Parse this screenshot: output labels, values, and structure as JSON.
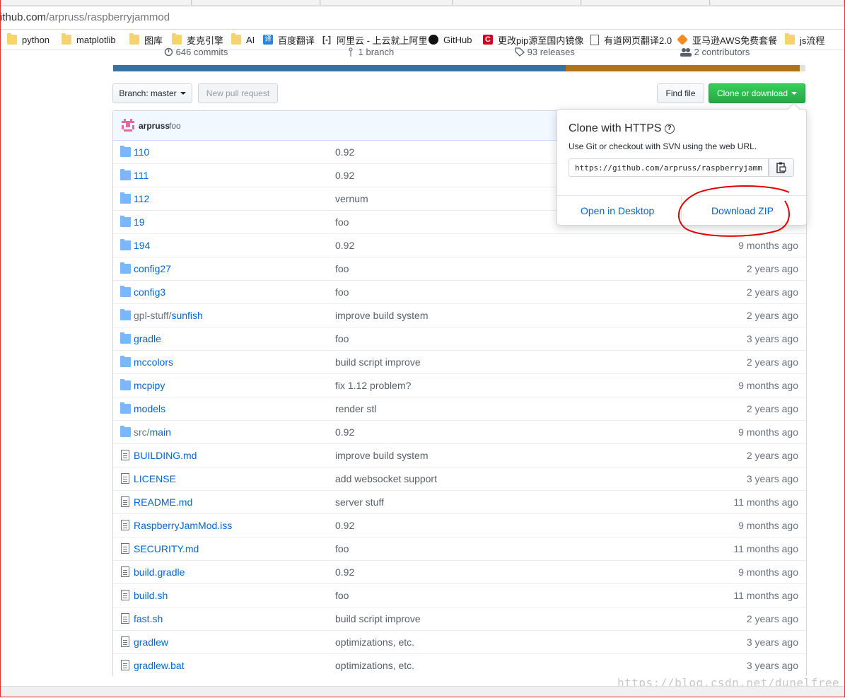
{
  "address_bar": {
    "domain": "ithub.com",
    "path": "/arpruss/raspberryjammod"
  },
  "bookmarks": [
    {
      "label": "python",
      "icon": "folder-icon"
    },
    {
      "label": "matplotlib",
      "icon": "folder-icon"
    },
    {
      "label": "图库",
      "icon": "folder-icon"
    },
    {
      "label": "麦克引擎",
      "icon": "folder-icon"
    },
    {
      "label": "AI",
      "icon": "folder-icon"
    },
    {
      "label": "百度翻译",
      "icon": "translate-icon"
    },
    {
      "label": "阿里云 - 上云就上阿里",
      "icon": "aliyun-icon"
    },
    {
      "label": "GitHub",
      "icon": "github-icon"
    },
    {
      "label": "更改pip源至国内镜像",
      "icon": "csdn-icon"
    },
    {
      "label": "有道网页翻译2.0",
      "icon": "page-icon"
    },
    {
      "label": "亚马逊AWS免费套餐",
      "icon": "aws-icon"
    },
    {
      "label": "js流程",
      "icon": "folder-icon"
    }
  ],
  "summary": {
    "commits": "646 commits",
    "branch": "1 branch",
    "releases": "93 releases",
    "contributors": "2 contributors"
  },
  "toolbar": {
    "branch_label": "Branch: master",
    "new_pr": "New pull request",
    "find_file": "Find file",
    "clone": "Clone or download"
  },
  "commit": {
    "author": "arpruss",
    "message": "foo"
  },
  "files": [
    {
      "type": "dir",
      "name": "110",
      "message": "0.92",
      "age": ""
    },
    {
      "type": "dir",
      "name": "111",
      "message": "0.92",
      "age": ""
    },
    {
      "type": "dir",
      "name": "112",
      "message": "vernum",
      "age": ""
    },
    {
      "type": "dir",
      "name": "19",
      "message": "foo",
      "age": ""
    },
    {
      "type": "dir",
      "name": "194",
      "message": "0.92",
      "age": "9 months ago"
    },
    {
      "type": "dir",
      "name": "config27",
      "message": "foo",
      "age": "2 years ago"
    },
    {
      "type": "dir",
      "name": "config3",
      "message": "foo",
      "age": "2 years ago"
    },
    {
      "type": "dir",
      "name_prefix": "gpl-stuff/",
      "name": "sunfish",
      "message": "improve build system",
      "age": "2 years ago"
    },
    {
      "type": "dir",
      "name": "gradle",
      "message": "foo",
      "age": "3 years ago"
    },
    {
      "type": "dir",
      "name": "mccolors",
      "message": "build script improve",
      "age": "2 years ago"
    },
    {
      "type": "dir",
      "name": "mcpipy",
      "message": "fix 1.12 problem?",
      "age": "9 months ago"
    },
    {
      "type": "dir",
      "name": "models",
      "message": "render stl",
      "age": "2 years ago"
    },
    {
      "type": "dir",
      "name_prefix": "src/",
      "name": "main",
      "message": "0.92",
      "age": "9 months ago"
    },
    {
      "type": "file",
      "name": "BUILDING.md",
      "message": "improve build system",
      "age": "2 years ago"
    },
    {
      "type": "file",
      "name": "LICENSE",
      "message": "add websocket support",
      "age": "3 years ago"
    },
    {
      "type": "file",
      "name": "README.md",
      "message": "server stuff",
      "age": "11 months ago"
    },
    {
      "type": "file",
      "name": "RaspberryJamMod.iss",
      "message": "0.92",
      "age": "9 months ago"
    },
    {
      "type": "file",
      "name": "SECURITY.md",
      "message": "foo",
      "age": "11 months ago"
    },
    {
      "type": "file",
      "name": "build.gradle",
      "message": "0.92",
      "age": "9 months ago"
    },
    {
      "type": "file",
      "name": "build.sh",
      "message": "foo",
      "age": "11 months ago"
    },
    {
      "type": "file",
      "name": "fast.sh",
      "message": "build script improve",
      "age": "2 years ago"
    },
    {
      "type": "file",
      "name": "gradlew",
      "message": "optimizations, etc.",
      "age": "3 years ago"
    },
    {
      "type": "file",
      "name": "gradlew.bat",
      "message": "optimizations, etc.",
      "age": "3 years ago"
    }
  ],
  "clone_popup": {
    "title": "Clone with HTTPS",
    "description": "Use Git or checkout with SVN using the web URL.",
    "url": "https://github.com/arpruss/raspberryjammod.git",
    "open_desktop": "Open in Desktop",
    "download_zip": "Download ZIP"
  },
  "watermark": "https://blog.csdn.net/dunelfree",
  "colors": {
    "accent": "#0366d6",
    "green": "#28a745",
    "lang_python": "#3572A5",
    "lang_java": "#b07219",
    "annotation": "#e00000"
  }
}
